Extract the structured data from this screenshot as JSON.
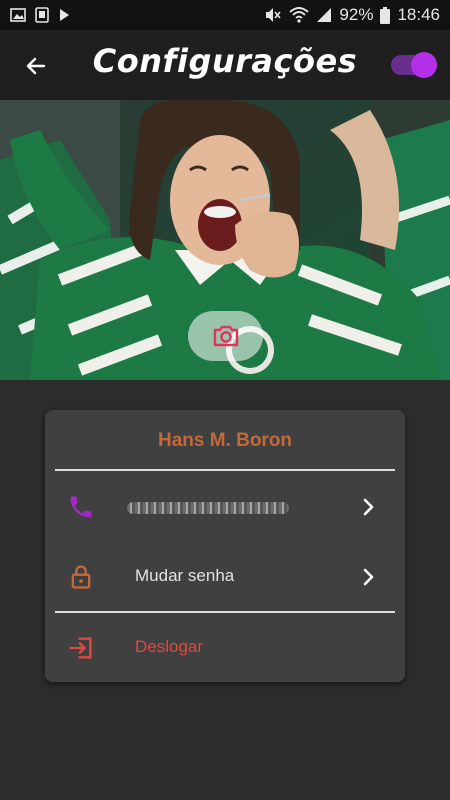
{
  "status_bar": {
    "battery": "92%",
    "time": "18:46"
  },
  "app_bar": {
    "title": "Configurações",
    "dark_mode_toggle": true,
    "toggle_color": "#b430e8"
  },
  "profile": {
    "name": "Hans M. Boron",
    "name_color": "#c26a3a",
    "phone": "(hidden)"
  },
  "menu": {
    "change_password": "Mudar senha",
    "logout": "Deslogar"
  },
  "icons": {
    "back": "arrow-left-icon",
    "camera": "camera-icon",
    "phone": "phone-icon",
    "lock": "lock-icon",
    "logout": "logout-icon",
    "chevron": "chevron-right-icon"
  },
  "colors": {
    "accent_purple": "#a229c4",
    "accent_orange": "#c26a3a",
    "logout_red": "#e0493e",
    "camera_pink": "#e0345e"
  }
}
